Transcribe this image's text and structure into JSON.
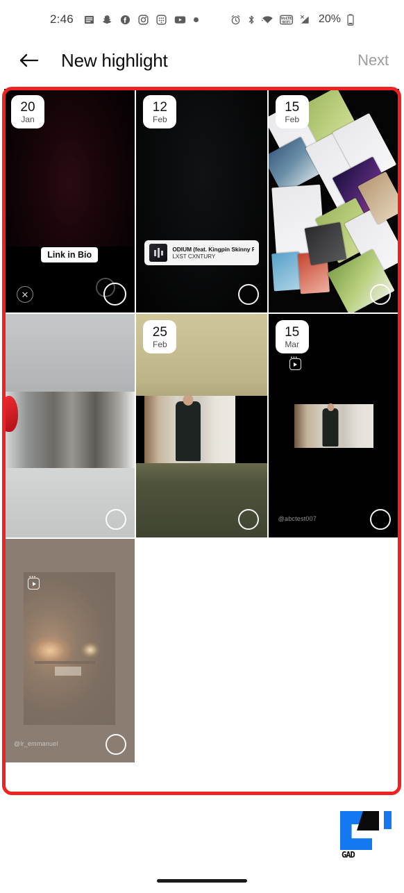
{
  "status_bar": {
    "time": "2:46",
    "battery_percent": "20%",
    "left_icons": [
      "news-icon",
      "snapchat-icon",
      "facebook-icon",
      "instagram-icon",
      "keypad-icon",
      "youtube-icon",
      "more-dot-icon"
    ],
    "right_icons": [
      "alarm-icon",
      "bluetooth-icon",
      "wifi-icon",
      "volte-wifi-icon",
      "signal-off-icon",
      "battery-icon"
    ],
    "volte_label": "VoLTE WiFi"
  },
  "header": {
    "back_label": "←",
    "title": "New highlight",
    "next_label": "Next"
  },
  "annotation": {
    "color": "#ef2222",
    "name": "story-grid-highlight-box"
  },
  "stories": [
    {
      "id": "story-1",
      "date_day": "20",
      "date_month": "Jan",
      "has_date": true,
      "sticker_text": "Link in Bio",
      "selected": false,
      "has_close": true,
      "has_cursor": true,
      "handle": "",
      "is_video": false
    },
    {
      "id": "story-2",
      "date_day": "12",
      "date_month": "Feb",
      "has_date": true,
      "music_title": "ODIUM (feat. Kingpin Skinny Pimp)",
      "music_artist": "LXST CXNTURY",
      "selected": false,
      "has_close": false,
      "has_cursor": false,
      "handle": "",
      "is_video": false
    },
    {
      "id": "story-3",
      "date_day": "15",
      "date_month": "Feb",
      "has_date": true,
      "selected": false,
      "has_close": false,
      "has_cursor": false,
      "handle": "",
      "is_video": false
    },
    {
      "id": "story-4",
      "date_day": "",
      "date_month": "",
      "has_date": false,
      "selected": false,
      "has_close": false,
      "has_cursor": false,
      "handle": "",
      "is_video": false
    },
    {
      "id": "story-5",
      "date_day": "25",
      "date_month": "Feb",
      "has_date": true,
      "selected": false,
      "has_close": false,
      "has_cursor": false,
      "handle": "",
      "is_video": false
    },
    {
      "id": "story-6",
      "date_day": "15",
      "date_month": "Mar",
      "has_date": true,
      "selected": false,
      "has_close": false,
      "has_cursor": false,
      "handle": "@abctest007",
      "is_video": true
    },
    {
      "id": "story-7",
      "date_day": "",
      "date_month": "",
      "has_date": false,
      "selected": false,
      "has_close": false,
      "has_cursor": false,
      "handle": "@lr_emmanuel",
      "is_video": true
    }
  ],
  "watermark": {
    "text": "GAD",
    "blue": "#1478f0",
    "black": "#0a0a0a"
  },
  "nav_bar": {
    "gesture_pill": "home-gesture-pill"
  }
}
